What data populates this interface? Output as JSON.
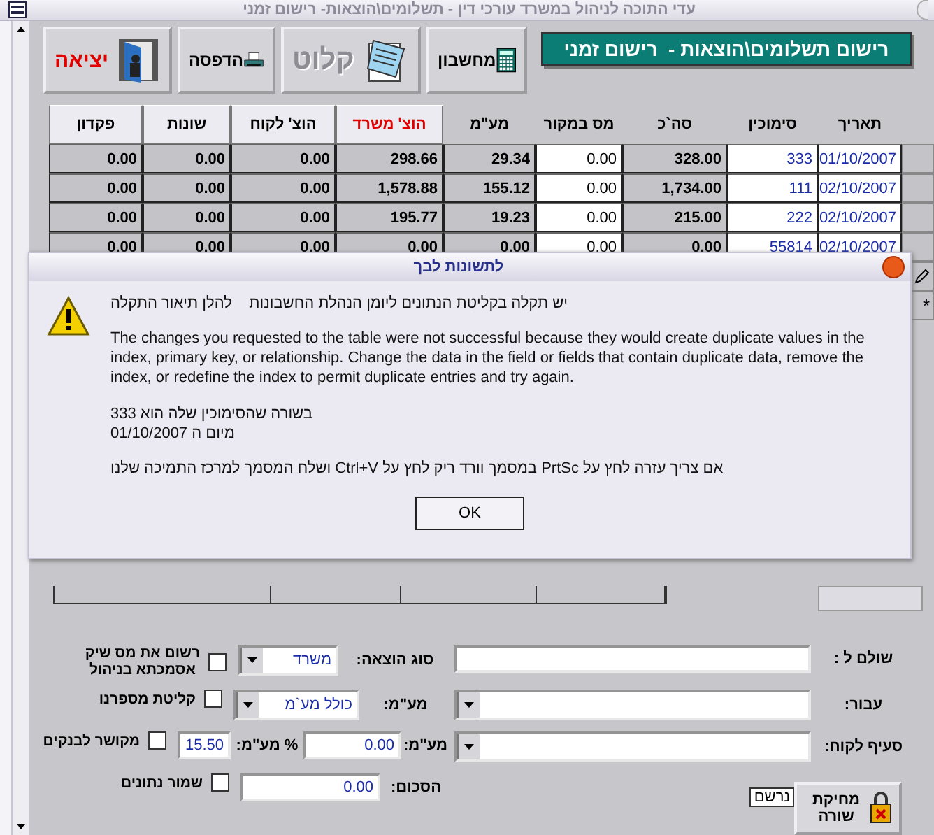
{
  "window": {
    "title": "עדי התוכה לניהול במשרד עורכי דין - תשלומים\\הוצאות- רישום זמני"
  },
  "form_title": "רישום תשלומים\\הוצאות -  רישום זמני",
  "toolbar": [
    {
      "label": "מחשבון",
      "kind": "calculator",
      "disabled": false
    },
    {
      "label": "קלוט",
      "kind": "capture",
      "disabled": true
    },
    {
      "label": "הדפסה",
      "kind": "print",
      "disabled": false
    },
    {
      "label": "יציאה",
      "kind": "exit",
      "disabled": false
    }
  ],
  "table": {
    "columns": [
      {
        "label": "תאריך",
        "kind": "link",
        "raised": false,
        "highlighted": false
      },
      {
        "label": "סימוכין",
        "kind": "link",
        "raised": false,
        "highlighted": false
      },
      {
        "label": "סה`כ",
        "kind": "number",
        "raised": false,
        "highlighted": false
      },
      {
        "label": "מס במקור",
        "kind": "input",
        "raised": false,
        "highlighted": false
      },
      {
        "label": "מע\"מ",
        "kind": "number",
        "raised": false,
        "highlighted": false
      },
      {
        "label": "הוצ' משרד",
        "kind": "number",
        "raised": true,
        "highlighted": true
      },
      {
        "label": "הוצ' לקוח",
        "kind": "number",
        "raised": true,
        "highlighted": false
      },
      {
        "label": "שונות",
        "kind": "number",
        "raised": true,
        "highlighted": false
      },
      {
        "label": "פקדון",
        "kind": "number",
        "raised": true,
        "highlighted": false
      }
    ],
    "rows": [
      {
        "cells": [
          "01/10/2007",
          "333",
          "328.00",
          "0.00",
          "29.34",
          "298.66",
          "0.00",
          "0.00",
          "0.00"
        ]
      },
      {
        "cells": [
          "02/10/2007",
          "111",
          "1,734.00",
          "0.00",
          "155.12",
          "1,578.88",
          "0.00",
          "0.00",
          "0.00"
        ]
      },
      {
        "cells": [
          "02/10/2007",
          "222",
          "215.00",
          "0.00",
          "19.23",
          "195.77",
          "0.00",
          "0.00",
          "0.00"
        ]
      },
      {
        "cells": [
          "02/10/2007",
          "55814",
          "0.00",
          "0.00",
          "0.00",
          "0.00",
          "0.00",
          "0.00",
          "0.00"
        ]
      }
    ],
    "new_row_marker": "*"
  },
  "dialog": {
    "title": "לתשונות לבך",
    "heading": "יש תקלה בקליטת הנתונים ליומן הנהלת החשבונות    להלן תיאור התקלה",
    "message": "The changes you requested to the table were not successful because they would create duplicate values in the index, primary key, or relationship.  Change the data in the field or fields that contain duplicate data, remove the index, or redefine the index to permit duplicate entries and try again.",
    "details": [
      "בשורה שהסימוכין שלה הוא 333",
      "מיום ה 01/10/2007"
    ],
    "help": "אם צריך עזרה לחץ על PrtSc במסמך וורד ריק לחץ על Ctrl+V ושלח המסמך למרכז התמיכה שלנו",
    "ok_button": "OK"
  },
  "form": {
    "paid_to": {
      "label": "שולם ל :"
    },
    "for": {
      "label": "עבור:"
    },
    "client_item": {
      "label": "סעיף לקוח:"
    },
    "expense_type": {
      "label": "סוג הוצאה:",
      "value": "משרד"
    },
    "vat_mode": {
      "label": "מע\"מ:",
      "value": "כולל מע`מ"
    },
    "vat_amount": {
      "label": "מע\"מ:",
      "value": "0.00"
    },
    "vat_rate": {
      "label": "% מע\"מ:",
      "value": "15.50"
    },
    "total": {
      "label": "הסכום:",
      "value": "0.00"
    },
    "checkboxes": [
      {
        "label_lines": [
          "רשום את מס שיק",
          "אסמכתא בניהול"
        ],
        "checked": false
      },
      {
        "label_lines": [
          "קליטת מספרנו"
        ],
        "checked": false
      },
      {
        "label_lines": [
          "מקושר לבנקים"
        ],
        "checked": false
      },
      {
        "label_lines": [
          "שמור נתונים"
        ],
        "checked": false
      }
    ],
    "status": "נרשם",
    "delete_button": "מחיקת שורה"
  }
}
